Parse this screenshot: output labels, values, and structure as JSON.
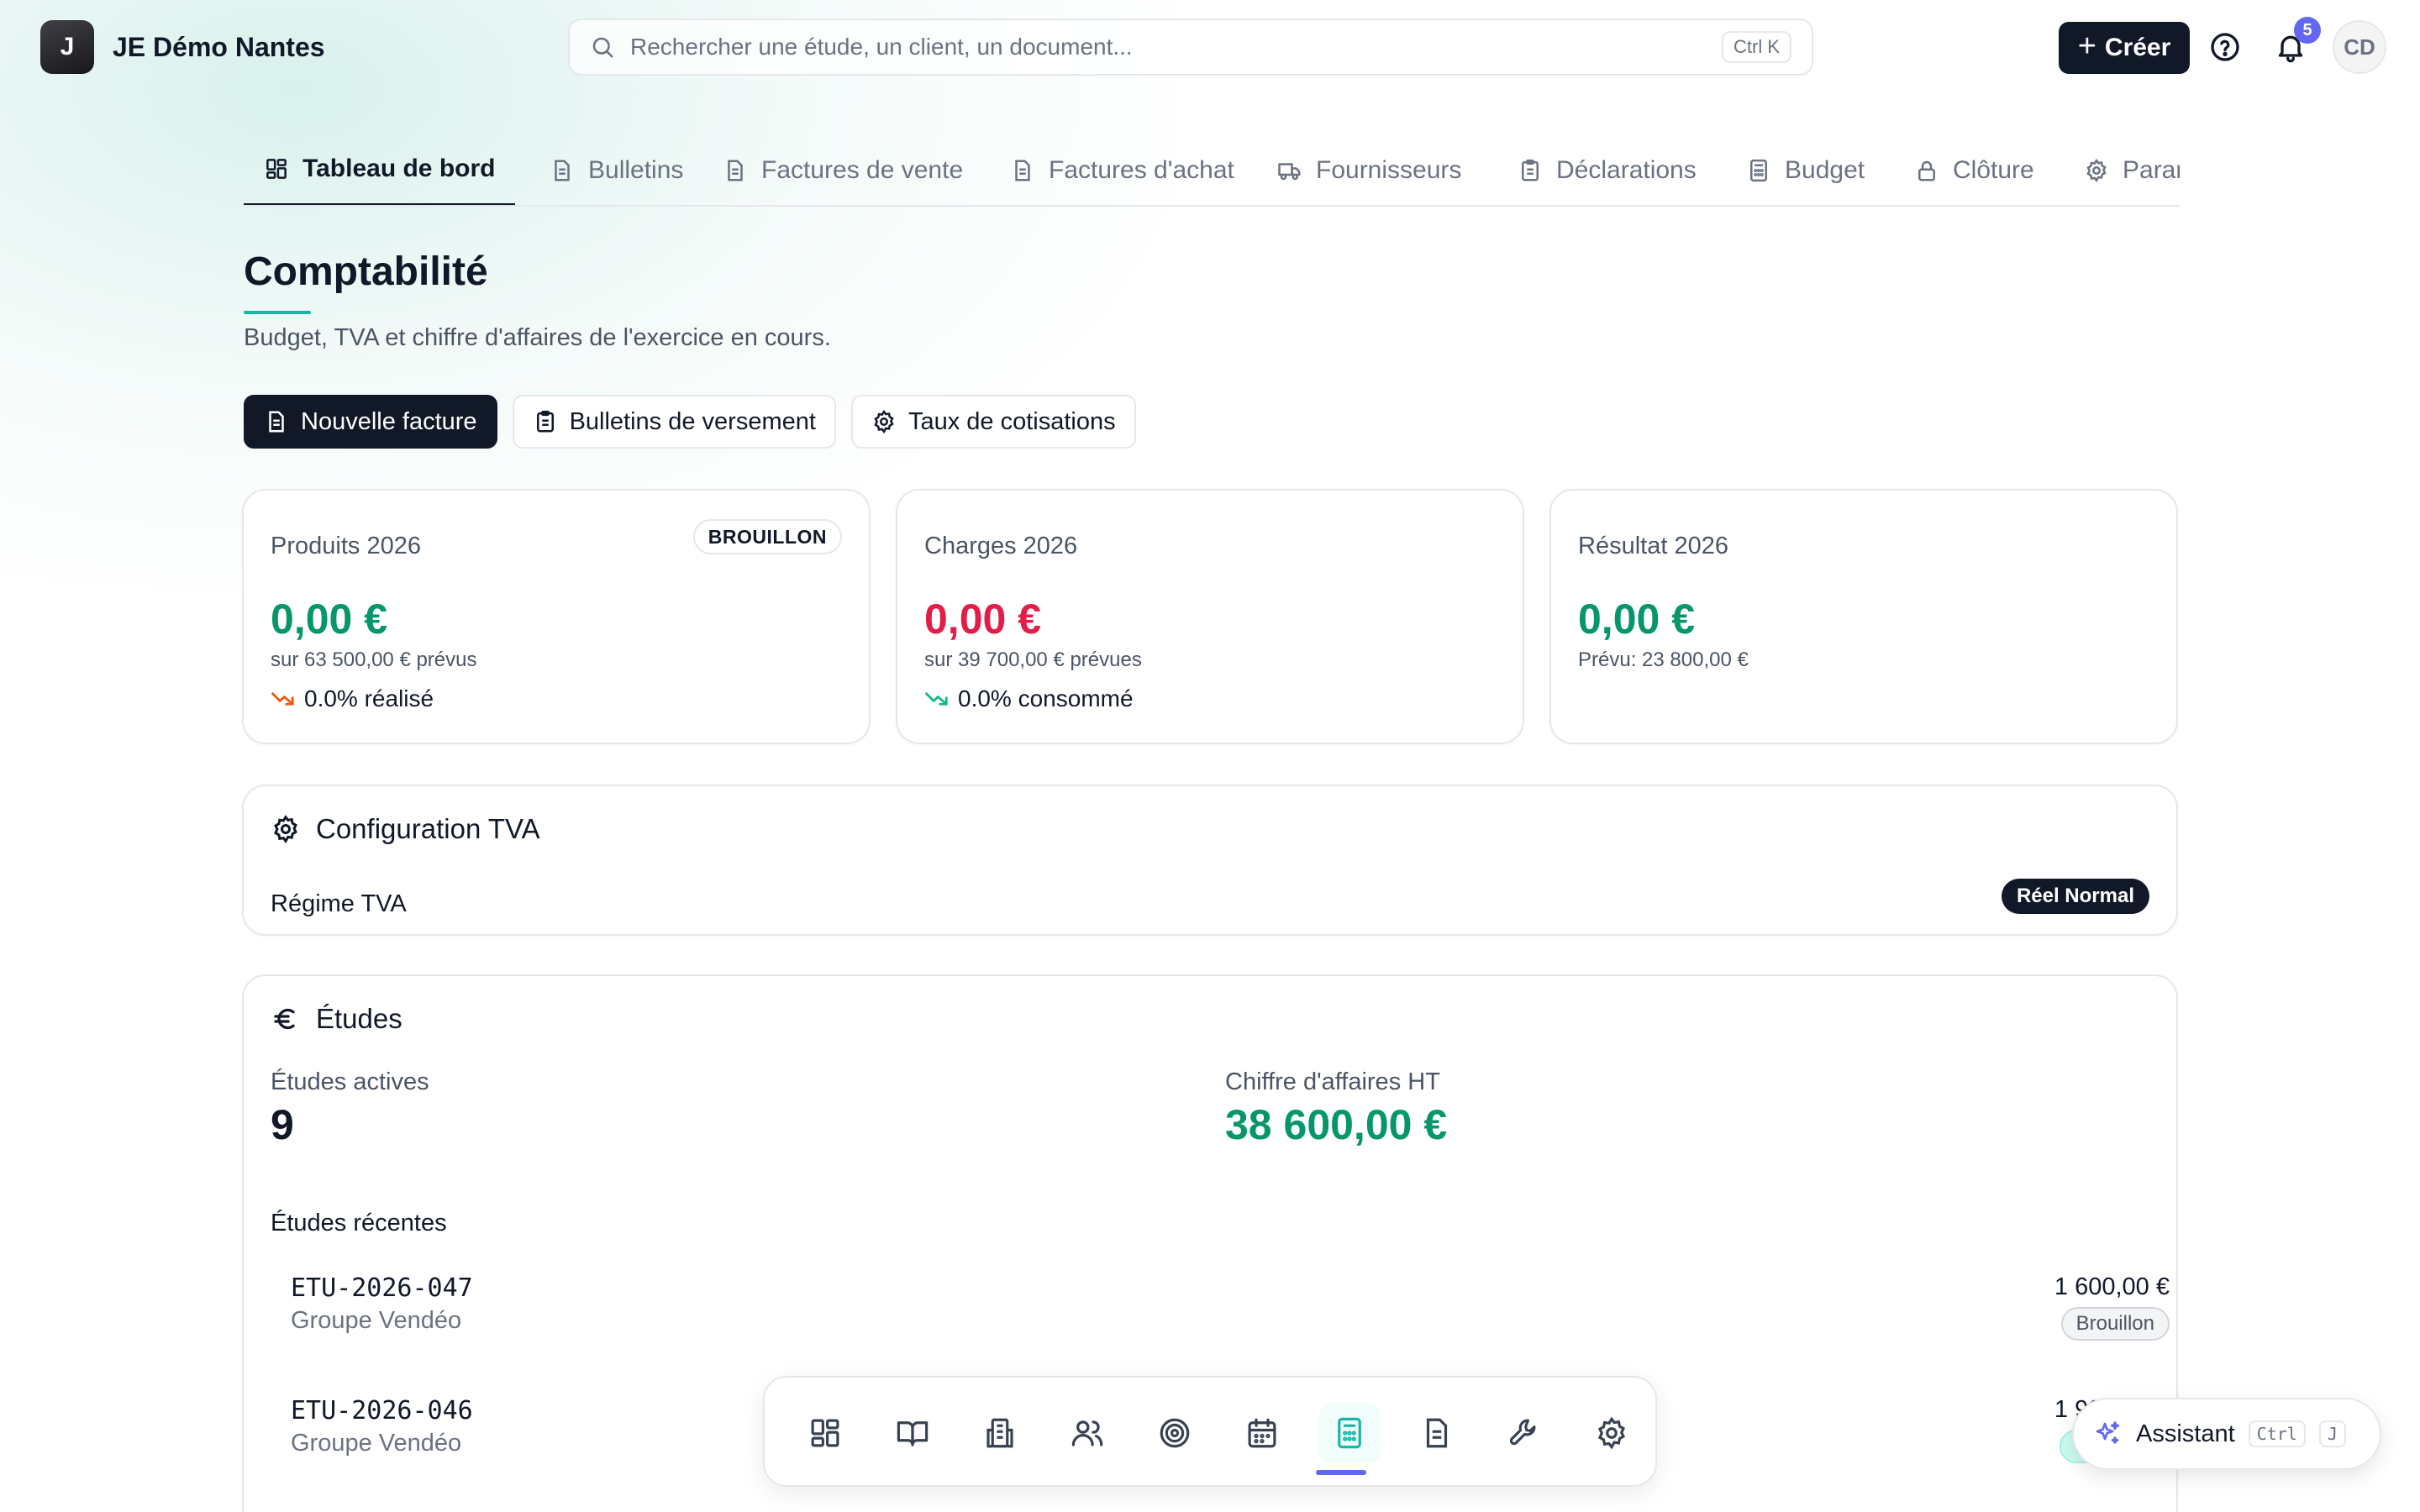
{
  "brand": {
    "initial": "J",
    "name": "JE Démo Nantes"
  },
  "search": {
    "placeholder": "Rechercher une étude, un client, un document...",
    "shortcut": "Ctrl K"
  },
  "header": {
    "create_label": "Créer",
    "notifications_count": "5",
    "avatar_initials": "CD"
  },
  "tabs": [
    {
      "label": "Tableau de bord",
      "icon": "dashboard-icon",
      "active": true
    },
    {
      "label": "Bulletins",
      "icon": "document-icon"
    },
    {
      "label": "Factures de vente",
      "icon": "document-icon"
    },
    {
      "label": "Factures d'achat",
      "icon": "document-icon"
    },
    {
      "label": "Fournisseurs",
      "icon": "truck-icon"
    },
    {
      "label": "Déclarations",
      "icon": "clipboard-icon"
    },
    {
      "label": "Budget",
      "icon": "calculator-icon"
    },
    {
      "label": "Clôture",
      "icon": "lock-icon"
    },
    {
      "label": "Paramètres",
      "icon": "gear-icon"
    }
  ],
  "page": {
    "title": "Comptabilité",
    "subtitle": "Budget, TVA et chiffre d'affaires de l'exercice en cours.",
    "actions": [
      {
        "label": "Nouvelle facture",
        "icon": "document-icon",
        "primary": true
      },
      {
        "label": "Bulletins de versement",
        "icon": "clipboard-icon"
      },
      {
        "label": "Taux de cotisations",
        "icon": "gear-icon"
      }
    ]
  },
  "stats": [
    {
      "label": "Produits 2026",
      "badge": "BROUILLON",
      "value": "0,00 €",
      "sub": "sur 63 500,00 € prévus",
      "trend": "0.0% réalisé",
      "color": "#059669"
    },
    {
      "label": "Charges 2026",
      "value": "0,00 €",
      "sub": "sur 39 700,00 € prévues",
      "trend": "0.0% consommé",
      "color": "#e11d48"
    },
    {
      "label": "Résultat 2026",
      "value": "0,00 €",
      "sub": "Prévu: 23 800,00 €",
      "color": "#059669"
    }
  ],
  "tva": {
    "title": "Configuration TVA",
    "regime_label": "Régime TVA",
    "regime_value": "Réel Normal"
  },
  "etudes": {
    "title": "Études",
    "active_label": "Études actives",
    "active_value": "9",
    "ca_label": "Chiffre d'affaires HT",
    "ca_value": "38 600,00 €",
    "recent_title": "Études récentes",
    "recent": [
      {
        "ref": "ETU-2026-047",
        "client": "Groupe Vendéo",
        "amount": "1 600,00 €",
        "status": "Brouillon"
      },
      {
        "ref": "ETU-2026-046",
        "client": "Groupe Vendéo",
        "amount": "1 900,00 €",
        "status": "En cours"
      }
    ]
  },
  "dock": [
    {
      "icon": "dashboard-icon"
    },
    {
      "icon": "book-icon"
    },
    {
      "icon": "building-icon"
    },
    {
      "icon": "users-icon"
    },
    {
      "icon": "target-icon"
    },
    {
      "icon": "calendar-icon"
    },
    {
      "icon": "calculator-icon",
      "active": true
    },
    {
      "icon": "document-icon"
    },
    {
      "icon": "wrench-icon"
    },
    {
      "icon": "gear-icon"
    }
  ],
  "assistant": {
    "label": "Assistant",
    "key1": "Ctrl",
    "key2": "J"
  },
  "colors": {
    "accent": "#14b8a6",
    "positive": "#059669",
    "negative": "#e11d48",
    "notification": "#6366f1",
    "dark": "#111827"
  }
}
